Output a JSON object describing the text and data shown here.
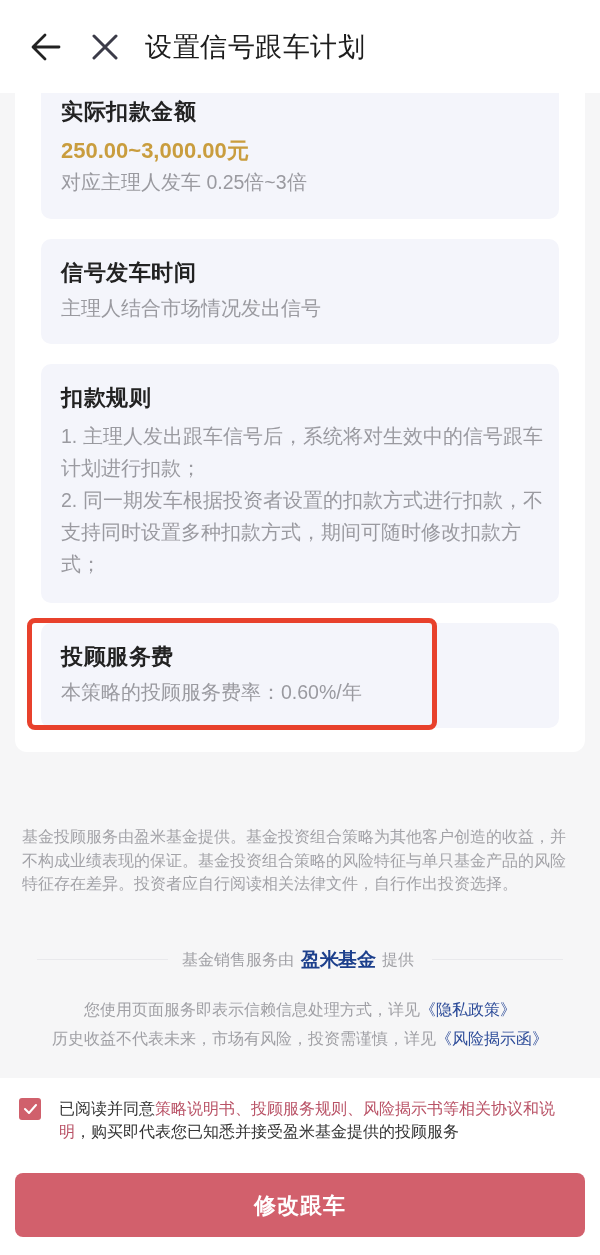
{
  "header": {
    "title": "设置信号跟车计划"
  },
  "sections": [
    {
      "title": "实际扣款金额",
      "amount": "250.00~3,000.00元",
      "lines": [
        "对应主理人发车 0.25倍~3倍"
      ],
      "highlighted": false
    },
    {
      "title": "信号发车时间",
      "lines": [
        "主理人结合市场情况发出信号"
      ],
      "highlighted": false
    },
    {
      "title": "扣款规则",
      "lines": [
        "1. 主理人发出跟车信号后，系统将对生效中的信号跟车计划进行扣款；",
        "2. 同一期发车根据投资者设置的扣款方式进行扣款，不支持同时设置多种扣款方式，期间可随时修改扣款方式；"
      ],
      "highlighted": false
    },
    {
      "title": "投顾服务费",
      "lines": [
        "本策略的投顾服务费率：0.60%/年"
      ],
      "highlighted": true
    }
  ],
  "disclaimer": "基金投顾服务由盈米基金提供。基金投资组合策略为其他客户创造的收益，并不构成业绩表现的保证。基金投资组合策略的风险特征与单只基金产品的风险特征存在差异。投资者应自行阅读相关法律文件，自行作出投资选择。",
  "provider": {
    "prefix": "基金销售服务由",
    "logo": "盈米基金",
    "suffix": "提供"
  },
  "notices": [
    {
      "text": "您使用页面服务即表示信赖信息处理方式，详见",
      "link": "《隐私政策》"
    },
    {
      "text": "历史收益不代表未来，市场有风险，投资需谨慎，详见",
      "link": "《风险揭示函》"
    }
  ],
  "agreement": {
    "checked": true,
    "parts": [
      {
        "kind": "text",
        "text": "已阅读并同意"
      },
      {
        "kind": "link",
        "text": "策略说明书、投顾服务规则、风险揭示书等相关协议和说"
      },
      {
        "kind": "link",
        "text": "明"
      },
      {
        "kind": "text",
        "text": "，购买即代表您已知悉并接受盈米基金提供的投顾服务"
      }
    ]
  },
  "submit_button": {
    "label": "修改跟车"
  }
}
